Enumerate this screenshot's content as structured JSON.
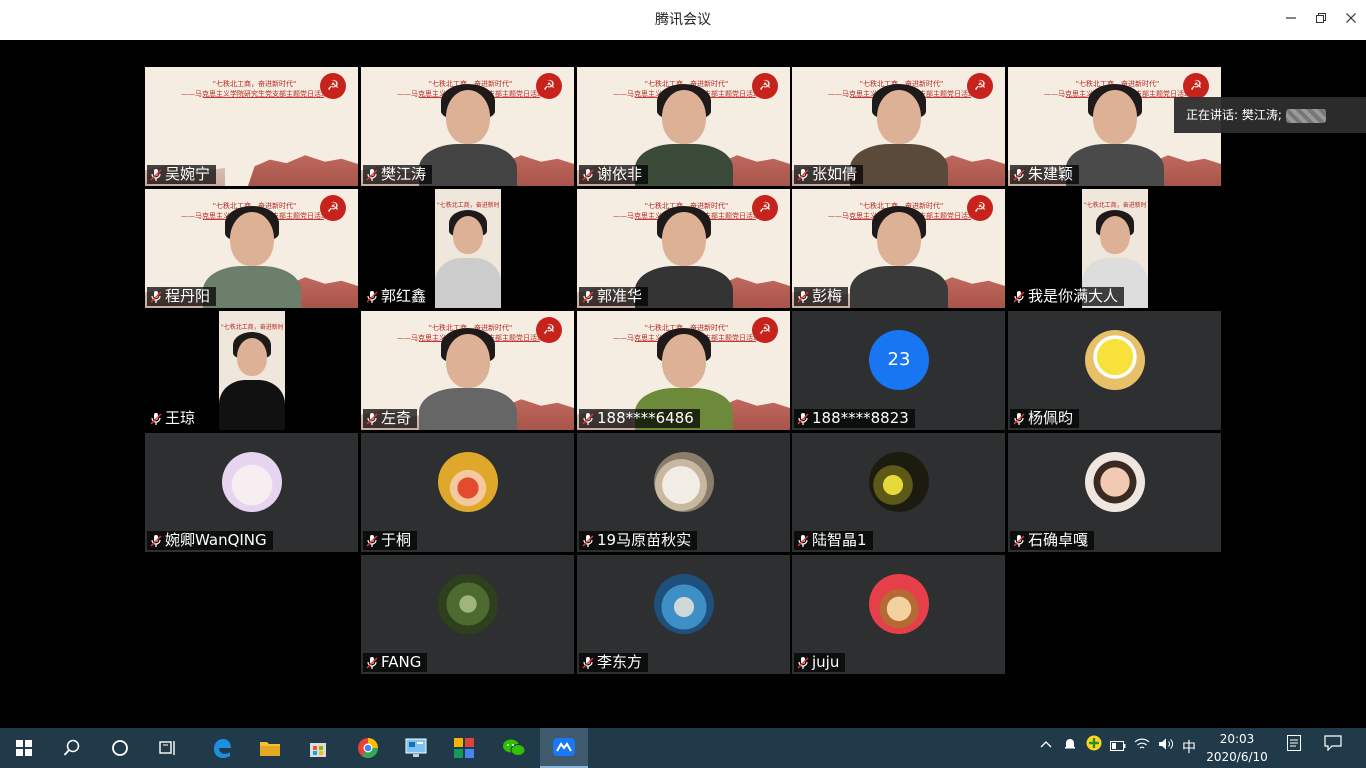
{
  "window": {
    "title": "腾讯会议"
  },
  "speaking": {
    "label": "正在讲话: 樊江涛;"
  },
  "slide": {
    "line1": "\"七秩北工商，奋进新时代\"",
    "line2": "——马克思主义学院研究生党支部主题党日活动"
  },
  "participants": [
    {
      "name": "吴婉宁",
      "type": "slide_only"
    },
    {
      "name": "樊江涛",
      "type": "camera",
      "active": true
    },
    {
      "name": "谢依非",
      "type": "camera"
    },
    {
      "name": "张如倩",
      "type": "camera"
    },
    {
      "name": "朱建颖",
      "type": "camera"
    },
    {
      "name": "程丹阳",
      "type": "camera"
    },
    {
      "name": "郭红鑫",
      "type": "camera_narrow"
    },
    {
      "name": "郭准华",
      "type": "camera"
    },
    {
      "name": "彭梅",
      "type": "camera"
    },
    {
      "name": "我是你满大人",
      "type": "camera_narrow"
    },
    {
      "name": "王琼",
      "type": "camera_narrow"
    },
    {
      "name": "左奇",
      "type": "camera"
    },
    {
      "name": "188****6486",
      "type": "camera"
    },
    {
      "name": "188****8823",
      "type": "number_avatar",
      "avatar_text": "23"
    },
    {
      "name": "杨佩昀",
      "type": "avatar",
      "icon": "sponge-avatar"
    },
    {
      "name": "婉卿WanQING",
      "type": "avatar",
      "icon": "bunny-avatar"
    },
    {
      "name": "于桐",
      "type": "avatar",
      "icon": "cartoon-boy-avatar"
    },
    {
      "name": "19马原苗秋实",
      "type": "avatar",
      "icon": "cat-avatar"
    },
    {
      "name": "陆智晶1",
      "type": "avatar",
      "icon": "night-avatar"
    },
    {
      "name": "石确卓嘎",
      "type": "avatar",
      "icon": "selfie-avatar"
    },
    {
      "name": "FANG",
      "type": "avatar",
      "icon": "forest-avatar"
    },
    {
      "name": "李东方",
      "type": "avatar",
      "icon": "ocean-avatar"
    },
    {
      "name": "juju",
      "type": "avatar",
      "icon": "bear-avatar"
    }
  ],
  "taskbar": {
    "ime": "中",
    "time": "20:03",
    "date": "2020/6/10"
  }
}
